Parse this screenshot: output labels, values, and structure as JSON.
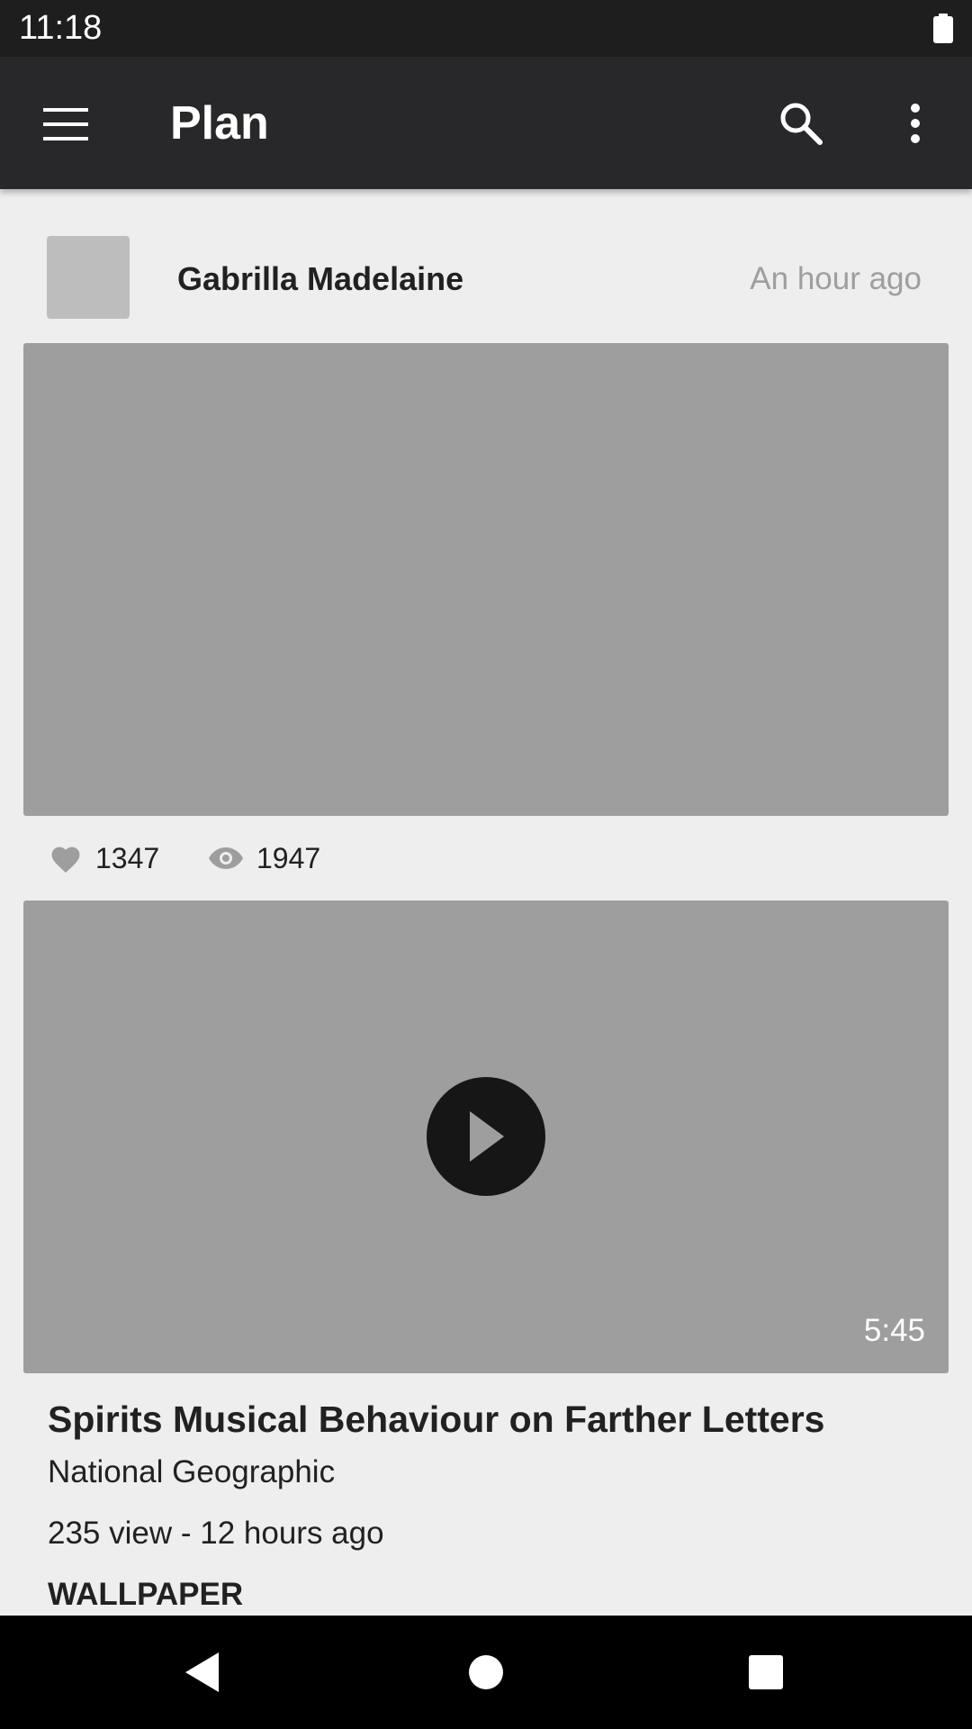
{
  "status_bar": {
    "time": "11:18",
    "battery_icon": "battery-full-icon"
  },
  "app_bar": {
    "title": "Plan",
    "menu_icon": "hamburger-menu-icon",
    "search_icon": "search-icon",
    "more_icon": "more-vert-icon"
  },
  "post": {
    "author": "Gabrilla Madelaine",
    "time_ago": "An hour ago",
    "likes": "1347",
    "views": "1947",
    "like_icon": "heart-icon",
    "view_icon": "eye-icon"
  },
  "video": {
    "duration": "5:45",
    "title": "Spirits Musical Behaviour on Farther Letters",
    "channel": "National Geographic",
    "meta": "235 view - 12 hours ago",
    "tag": "WALLPAPER",
    "play_icon": "play-icon"
  },
  "nav_bar": {
    "back_icon": "back-triangle-icon",
    "home_icon": "home-circle-icon",
    "recents_icon": "recents-square-icon"
  },
  "colors": {
    "status_bar": "#1e1e1f",
    "app_bar": "#28282a",
    "background": "#eeeeee",
    "placeholder": "#9e9e9e",
    "avatar_placeholder": "#bdbdbd",
    "play_button": "#161616",
    "secondary_text": "#9e9e9e"
  }
}
